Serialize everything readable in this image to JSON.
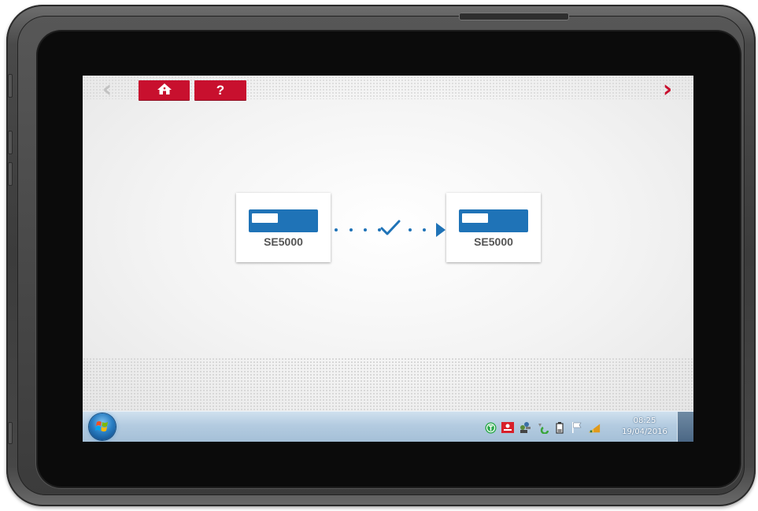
{
  "app": {
    "nav_back_glyph": "‹",
    "nav_next_glyph": "›",
    "home_icon": "home-icon",
    "help_label": "?",
    "devices": [
      {
        "label": "SE5000"
      },
      {
        "label": "SE5000"
      }
    ],
    "transfer_icon": "check-arrow-icon",
    "colors": {
      "accent_red": "#c8102e",
      "device_blue": "#1f73b7"
    }
  },
  "taskbar": {
    "start_icon": "windows-start-orb",
    "tray_icons": [
      "tachograph-icon",
      "id-card-icon",
      "network-users-icon",
      "recycle-icon",
      "battery-icon",
      "flag-icon",
      "signal-icon"
    ],
    "time": "08:25",
    "date": "19/04/2016"
  }
}
